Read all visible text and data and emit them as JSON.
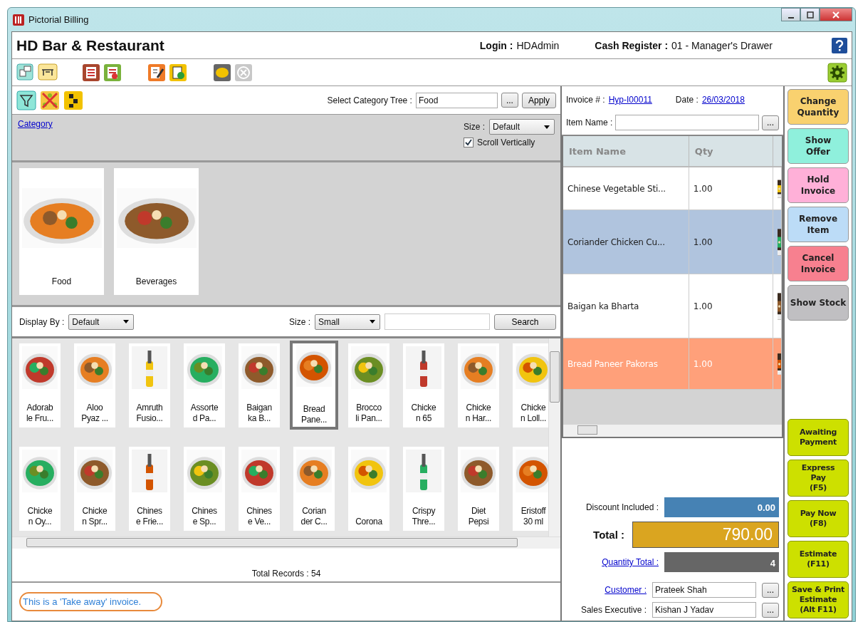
{
  "window": {
    "title": "Pictorial Billing"
  },
  "header": {
    "business_name": "HD Bar & Restaurant",
    "login_label": "Login :",
    "login_value": "HDAdmin",
    "register_label": "Cash Register :",
    "register_value": "01 - Manager's Drawer"
  },
  "toolbar": [
    {
      "kind": "monitor",
      "disabled": false
    },
    {
      "kind": "table",
      "disabled": false
    },
    {
      "kind": "calculator",
      "disabled": false
    },
    {
      "kind": "report",
      "disabled": false
    },
    {
      "kind": "edit",
      "disabled": false
    },
    {
      "kind": "document",
      "disabled": false
    },
    {
      "kind": "coin",
      "disabled": false
    },
    {
      "kind": "close",
      "disabled": true
    }
  ],
  "category_panel": {
    "tree_label": "Select Category Tree :",
    "tree_value": "Food",
    "browse_button": "...",
    "apply_button": "Apply",
    "category_link": "Category",
    "size_label": "Size :",
    "size_value": "Default",
    "scroll_vertically": {
      "label": "Scroll Vertically",
      "checked": true
    },
    "categories": [
      {
        "name": "Food"
      },
      {
        "name": "Beverages"
      }
    ]
  },
  "items_panel": {
    "display_by_label": "Display By :",
    "display_by_value": "Default",
    "size_label": "Size :",
    "size_value": "Small",
    "search_button": "Search",
    "total_records": "Total Records : 54",
    "items": [
      {
        "name": "Adorab\nle Fru...",
        "selected": false
      },
      {
        "name": "Aloo\nPyaz ...",
        "selected": false
      },
      {
        "name": "Amruth\nFusio...",
        "selected": false
      },
      {
        "name": "Assorte\nd Pa...",
        "selected": false
      },
      {
        "name": "Baigan\nka B...",
        "selected": false
      },
      {
        "name": "Bread\nPane...",
        "selected": true
      },
      {
        "name": "Brocco\nli Pan...",
        "selected": false
      },
      {
        "name": "Chicke\nn 65",
        "selected": false
      },
      {
        "name": "Chicke\nn Har...",
        "selected": false
      },
      {
        "name": "Chicke\nn Loll...",
        "selected": false
      },
      {
        "name": "Chicke\nn Oy...",
        "selected": false
      },
      {
        "name": "Chicke\nn Spr...",
        "selected": false
      },
      {
        "name": "Chines\ne Frie...",
        "selected": false
      },
      {
        "name": "Chines\ne Sp...",
        "selected": false
      },
      {
        "name": "Chines\ne Ve...",
        "selected": false
      },
      {
        "name": "Corian\nder C...",
        "selected": false
      },
      {
        "name": "Corona",
        "selected": false
      },
      {
        "name": "Crispy\nThre...",
        "selected": false
      },
      {
        "name": "Diet\nPepsi",
        "selected": false
      },
      {
        "name": "Eristoff\n30 ml",
        "selected": false
      }
    ]
  },
  "note": "This is a 'Take away' invoice.",
  "invoice": {
    "number_label": "Invoice # :",
    "number": "Hyp-I00011",
    "date_label": "Date :",
    "date": "26/03/2018",
    "item_name_label": "Item Name :",
    "item_browse": "...",
    "columns": [
      "Item Name",
      "Qty"
    ],
    "rows": [
      {
        "name": "Chinese Vegetable Sti...",
        "qty": "1.00",
        "color": "#ffffff"
      },
      {
        "name": "Coriander Chicken Cu...",
        "qty": "1.00",
        "color": "#b0c4de"
      },
      {
        "name": "Baigan ka Bharta",
        "qty": "1.00",
        "color": "#ffffff"
      },
      {
        "name": "Bread Paneer Pakoras",
        "qty": "1.00",
        "color": "#ffa07a"
      }
    ]
  },
  "totals": {
    "discount_label": "Discount Included :",
    "discount": "0.00",
    "total_label": "Total :",
    "total": "790.00",
    "quantity_label": "Quantity Total :",
    "quantity": "4",
    "customer_label": "Customer :",
    "customer": "Prateek Shah",
    "customer_browse": "...",
    "executive_label": "Sales Executive :",
    "executive": "Kishan J Yadav",
    "executive_browse": "..."
  },
  "actions": [
    {
      "label": "Change\nQuantity",
      "color": "#f9d16f",
      "kind": "top"
    },
    {
      "label": "Show\nOffer",
      "color": "#8ff0dc",
      "kind": "top"
    },
    {
      "label": "Hold\nInvoice",
      "color": "#ffb0d8",
      "kind": "top"
    },
    {
      "label": "Remove\nItem",
      "color": "#bcdcf7",
      "kind": "top"
    },
    {
      "label": "Cancel\nInvoice",
      "color": "#f7808f",
      "kind": "top"
    },
    {
      "label": "Show Stock",
      "color": "#c0bfc2",
      "kind": "top"
    },
    {
      "label": "Awaiting\nPayment",
      "color": "#cde000",
      "kind": "bottom"
    },
    {
      "label": "Express\nPay\n(F5)",
      "color": "#cde000",
      "kind": "bottom"
    },
    {
      "label": "Pay Now\n(F8)",
      "color": "#cde000",
      "kind": "bottom"
    },
    {
      "label": "Estimate\n(F11)",
      "color": "#cde000",
      "kind": "bottom"
    },
    {
      "label": "Save & Print\nEstimate\n(Alt F11)",
      "color": "#cde000",
      "kind": "bottom"
    }
  ]
}
